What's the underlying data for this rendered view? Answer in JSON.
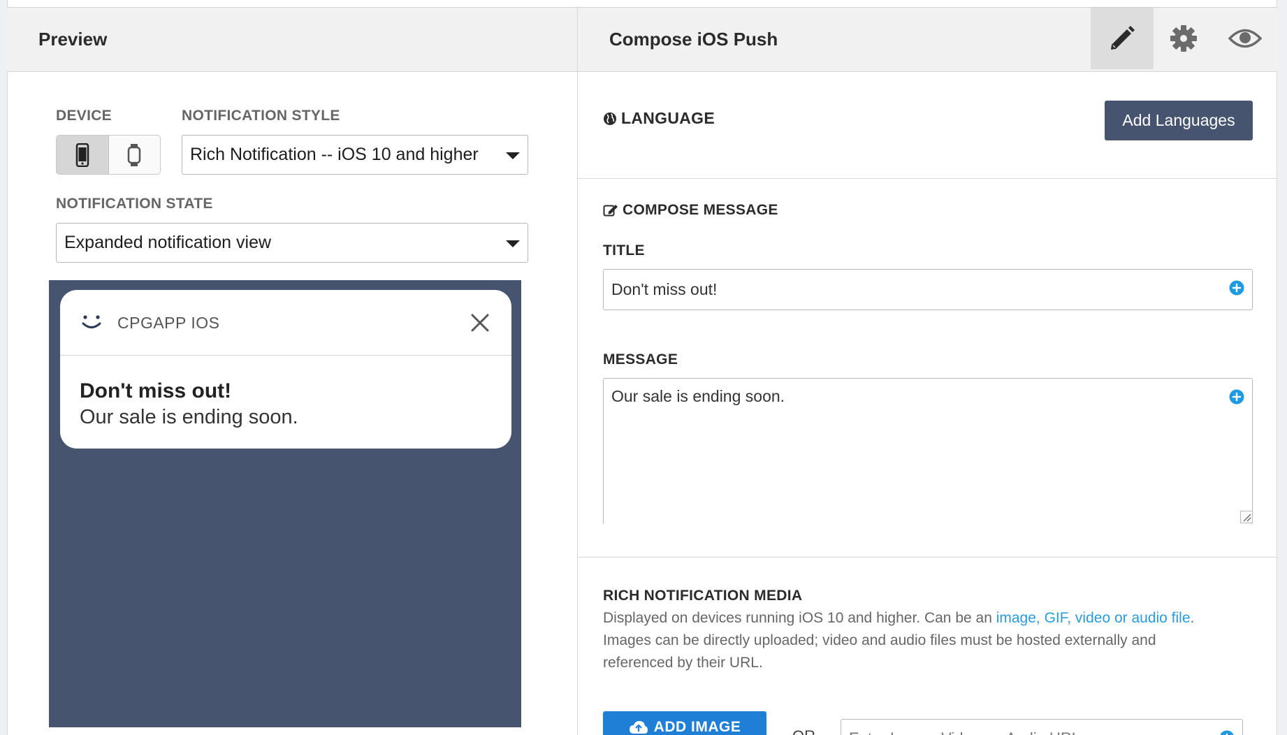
{
  "preview_panel": {
    "title": "Preview",
    "device_label": "DEVICE",
    "style_label": "NOTIFICATION STYLE",
    "style_value": "Rich Notification -- iOS 10 and higher",
    "state_label": "NOTIFICATION STATE",
    "state_value": "Expanded notification view",
    "notification": {
      "app_name": "CPGAPP IOS",
      "title": "Don't miss out!",
      "body": "Our sale is ending soon."
    }
  },
  "compose_panel": {
    "title": "Compose iOS Push",
    "toolbar": {
      "edit_icon": "pencil-icon",
      "settings_icon": "gear-icon",
      "preview_icon": "eye-icon"
    },
    "language": {
      "heading": "LANGUAGE",
      "add_button": "Add Languages"
    },
    "compose": {
      "heading": "COMPOSE MESSAGE",
      "title_label": "TITLE",
      "title_value": "Don't miss out!",
      "message_label": "MESSAGE",
      "message_value": "Our sale is ending soon."
    },
    "media": {
      "heading": "RICH NOTIFICATION MEDIA",
      "help_1": "Displayed on devices running iOS 10 and higher. Can be an ",
      "help_link": "image, GIF, video or audio file",
      "help_2": ".",
      "help_3": "Images can be directly uploaded; video and audio files must be hosted externally and",
      "help_4": "referenced by their URL.",
      "add_image_button": "ADD IMAGE",
      "or_text": "OR",
      "url_placeholder": "Enter Image, Video, or Audio URL"
    }
  },
  "colors": {
    "accent_dark": "#46546f",
    "accent_blue": "#1f7fd6",
    "link": "#2a9bdc"
  }
}
